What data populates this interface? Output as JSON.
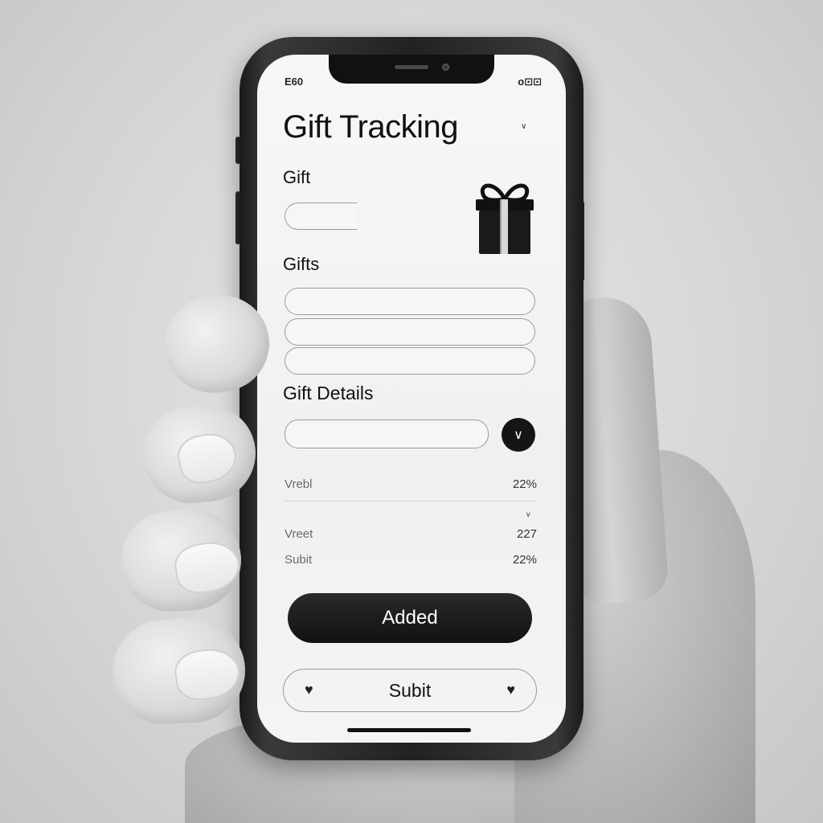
{
  "status_bar": {
    "time": "E60",
    "right_indicators": "o⊡⊡"
  },
  "app": {
    "title": "Gift Tracking",
    "title_menu_icon": "chevron-down-icon"
  },
  "form": {
    "gift_label": "Gift",
    "gift_value": "",
    "gifts_label": "Gifts",
    "gifts_values": [
      "",
      "",
      ""
    ],
    "details_label": "Gift Details",
    "details_value": "",
    "details_toggle_icon": "chevron-down-icon",
    "gift_image_icon": "gift-box-icon"
  },
  "summary": {
    "rows": [
      {
        "label": "Vrebl",
        "value": "22%"
      },
      {
        "label": "Vreet",
        "value": "227"
      },
      {
        "label": "Subit",
        "value": "22%"
      }
    ]
  },
  "actions": {
    "added_label": "Added",
    "submit_label": "Subit",
    "submit_icon_left": "heart-icon",
    "submit_icon_right": "heart-icon"
  },
  "colors": {
    "primary_button": "#111111",
    "screen_bg": "#f4f4f4",
    "phone_frame": "#222222"
  }
}
